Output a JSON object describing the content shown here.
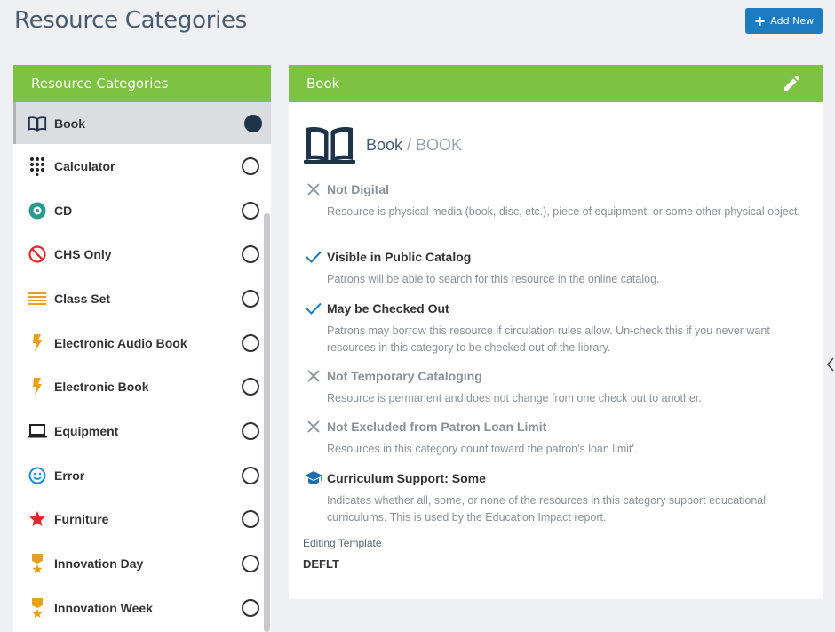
{
  "page": {
    "title": "Resource Categories"
  },
  "toolbar": {
    "add_label": "Add New"
  },
  "sidebar": {
    "header": "Resource Categories",
    "items": [
      {
        "label": "Book",
        "icon": "book-icon",
        "selected": true
      },
      {
        "label": "Calculator",
        "icon": "calculator-icon",
        "selected": false
      },
      {
        "label": "CD",
        "icon": "cd-icon",
        "selected": false
      },
      {
        "label": "CHS Only",
        "icon": "no-icon",
        "selected": false
      },
      {
        "label": "Class Set",
        "icon": "list-icon",
        "selected": false
      },
      {
        "label": "Electronic Audio Book",
        "icon": "bolt-icon",
        "selected": false
      },
      {
        "label": "Electronic Book",
        "icon": "bolt-icon",
        "selected": false
      },
      {
        "label": "Equipment",
        "icon": "laptop-icon",
        "selected": false
      },
      {
        "label": "Error",
        "icon": "smiley-icon",
        "selected": false
      },
      {
        "label": "Furniture",
        "icon": "star-icon",
        "selected": false
      },
      {
        "label": "Innovation Day",
        "icon": "medal-icon",
        "selected": false
      },
      {
        "label": "Innovation Week",
        "icon": "medal-icon",
        "selected": false
      }
    ]
  },
  "detail": {
    "header": "Book",
    "name": "Book",
    "separator": " / ",
    "code": "BOOK",
    "properties": [
      {
        "title": "Not Digital",
        "state": "off",
        "desc": "Resource is physical media (book, disc, etc.), piece of equipment, or some other physical object."
      },
      {
        "title": "Visible in Public Catalog",
        "state": "on",
        "desc": "Patrons will be able to search for this resource in the online catalog."
      },
      {
        "title": "May be Checked Out",
        "state": "on",
        "desc": "Patrons may borrow this resource if circulation rules allow. Un-check this if you never want resources in this category to be checked out of the library."
      },
      {
        "title": "Not Temporary Cataloging",
        "state": "off",
        "desc": "Resource is permanent and does not change from one check out to another."
      },
      {
        "title": "Not Excluded from Patron Loan Limit",
        "state": "off",
        "desc": "Resources in this category count toward the patron's loan limit'."
      },
      {
        "title": "Curriculum Support: Some",
        "state": "cap",
        "desc": "Indicates whether all, some, or none of the resources in this category support educational curriculums. This is used by the Education Impact report."
      }
    ],
    "template_label": "Editing Template",
    "template_value": "DEFLT"
  },
  "colors": {
    "green": "#7dc242",
    "blue": "#1d7bc0",
    "navy": "#1f3349"
  }
}
